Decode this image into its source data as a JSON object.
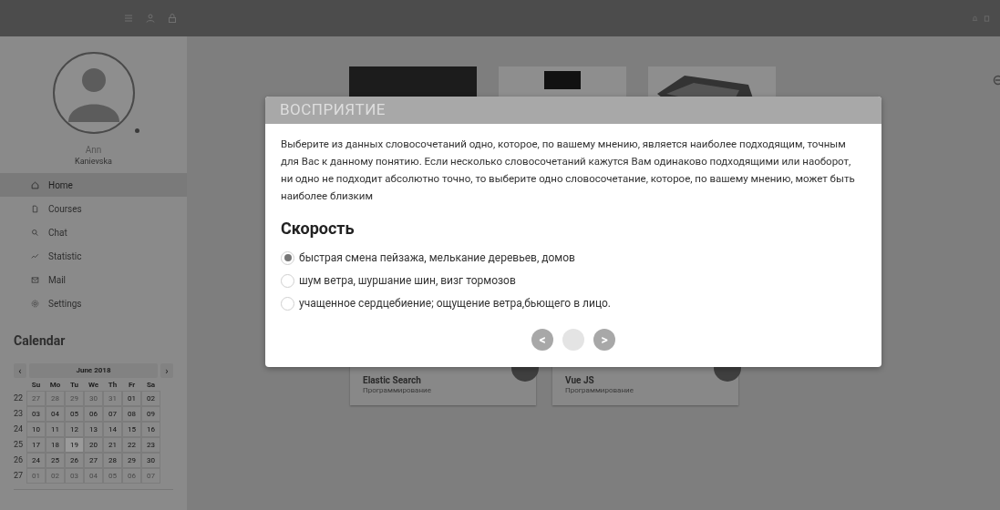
{
  "sidebar": {
    "user": {
      "first_name": "Ann",
      "last_name": "Kanievska",
      "online": true
    },
    "nav": [
      {
        "label": "Home",
        "selected": true
      },
      {
        "label": "Courses",
        "selected": false
      },
      {
        "label": "Chat",
        "selected": false
      },
      {
        "label": "Statistic",
        "selected": false
      },
      {
        "label": "Mail",
        "selected": false
      },
      {
        "label": "Settings",
        "selected": false
      }
    ]
  },
  "calendar": {
    "title": "Calendar",
    "prev": "‹",
    "month": "June 2018",
    "next": "›",
    "weekdays": [
      "Su",
      "Mo",
      "Tu",
      "We",
      "Th",
      "Fr",
      "Sa"
    ],
    "weeks": [
      {
        "number": "22",
        "days": [
          {
            "text": "27",
            "muted": true,
            "selected": false
          },
          {
            "text": "28",
            "muted": true,
            "selected": false
          },
          {
            "text": "29",
            "muted": true,
            "selected": false
          },
          {
            "text": "30",
            "muted": true,
            "selected": false
          },
          {
            "text": "31",
            "muted": true,
            "selected": false
          },
          {
            "text": "01",
            "muted": false,
            "selected": false
          },
          {
            "text": "02",
            "muted": false,
            "selected": false
          }
        ]
      },
      {
        "number": "23",
        "days": [
          {
            "text": "03",
            "muted": false,
            "selected": false
          },
          {
            "text": "04",
            "muted": false,
            "selected": false
          },
          {
            "text": "05",
            "muted": false,
            "selected": false
          },
          {
            "text": "06",
            "muted": false,
            "selected": false
          },
          {
            "text": "07",
            "muted": false,
            "selected": false
          },
          {
            "text": "08",
            "muted": false,
            "selected": false
          },
          {
            "text": "09",
            "muted": false,
            "selected": false
          }
        ]
      },
      {
        "number": "24",
        "days": [
          {
            "text": "10",
            "muted": false,
            "selected": false
          },
          {
            "text": "11",
            "muted": false,
            "selected": false
          },
          {
            "text": "12",
            "muted": false,
            "selected": false
          },
          {
            "text": "13",
            "muted": false,
            "selected": false
          },
          {
            "text": "14",
            "muted": false,
            "selected": false
          },
          {
            "text": "15",
            "muted": false,
            "selected": false
          },
          {
            "text": "16",
            "muted": false,
            "selected": false
          }
        ]
      },
      {
        "number": "25",
        "days": [
          {
            "text": "17",
            "muted": false,
            "selected": false
          },
          {
            "text": "18",
            "muted": false,
            "selected": false
          },
          {
            "text": "19",
            "muted": false,
            "selected": true
          },
          {
            "text": "20",
            "muted": false,
            "selected": false
          },
          {
            "text": "21",
            "muted": false,
            "selected": false
          },
          {
            "text": "22",
            "muted": false,
            "selected": false
          },
          {
            "text": "23",
            "muted": false,
            "selected": false
          }
        ]
      },
      {
        "number": "26",
        "days": [
          {
            "text": "24",
            "muted": false,
            "selected": false
          },
          {
            "text": "25",
            "muted": false,
            "selected": false
          },
          {
            "text": "26",
            "muted": false,
            "selected": false
          },
          {
            "text": "27",
            "muted": false,
            "selected": false
          },
          {
            "text": "28",
            "muted": false,
            "selected": false
          },
          {
            "text": "29",
            "muted": false,
            "selected": false
          },
          {
            "text": "30",
            "muted": false,
            "selected": false
          }
        ]
      },
      {
        "number": "27",
        "days": [
          {
            "text": "01",
            "muted": true,
            "selected": false
          },
          {
            "text": "02",
            "muted": true,
            "selected": false
          },
          {
            "text": "03",
            "muted": true,
            "selected": false
          },
          {
            "text": "04",
            "muted": true,
            "selected": false
          },
          {
            "text": "05",
            "muted": true,
            "selected": false
          },
          {
            "text": "06",
            "muted": true,
            "selected": false
          },
          {
            "text": "07",
            "muted": true,
            "selected": false
          }
        ]
      }
    ]
  },
  "course_cards": [
    {
      "title": "Elastic Search",
      "subtitle": "Программирование"
    },
    {
      "title": "Vue JS",
      "subtitle": "Программирование"
    }
  ],
  "dialog": {
    "title": "ВОСПРИЯТИЕ",
    "instructions": "Выберите из данных словосочетаний одно, которое, по вашему мнению, является наиболее подходящим, точным для Вас к данному понятию. Если несколько словосочетаний кажутся Вам одинаково подходящими или наоборот, ни одно не подходит абсолютно точно, то выберите одно словосочетание, которое, по вашему мнению, может быть наиболее близким",
    "question": "Скорость",
    "options": [
      {
        "label": "быстрая смена пейзажа, мелькание деревьев, домов",
        "selected": true
      },
      {
        "label": "шум ветра, шуршание шин, визг тормозов",
        "selected": false
      },
      {
        "label": "учащенное сердцебиение; ощущение ветра,бьющего в лицо.",
        "selected": false
      }
    ],
    "prev": "<",
    "next": ">"
  }
}
